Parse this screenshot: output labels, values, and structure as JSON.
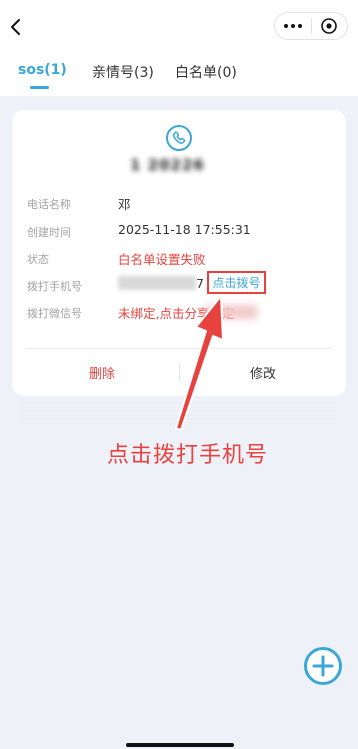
{
  "tabs": [
    {
      "label": "sos(1)",
      "active": true
    },
    {
      "label": "亲情号(3)",
      "active": false
    },
    {
      "label": "白名单(0)",
      "active": false
    }
  ],
  "card": {
    "number": "1     20226",
    "fields": [
      {
        "label": "电话名称",
        "value": "邓"
      },
      {
        "label": "创建时间",
        "value": "2025-11-18 17:55:31"
      },
      {
        "label": "状态",
        "value": "白名单设置失败"
      },
      {
        "label": "拨打手机号",
        "value": "7",
        "link": "点击拨号"
      },
      {
        "label": "拨打微信号",
        "value": "未绑定,点击分享绑定"
      }
    ],
    "delete_label": "删除",
    "edit_label": "修改"
  },
  "annotation": "点击拨打手机号",
  "colors": {
    "accent": "#3aa7d7",
    "danger": "#e8423f",
    "background": "#eff1f9"
  },
  "icons": [
    "back-icon",
    "more-icon",
    "close-target-icon",
    "phone-icon",
    "add-circle-icon"
  ]
}
